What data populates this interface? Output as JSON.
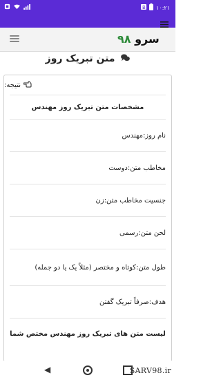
{
  "status_bar": {
    "time": "۱۰:۲۱",
    "left_icons": [
      "bug-icon",
      "wifi-icon",
      "signal-icon"
    ],
    "right_icons": [
      "battery-icon",
      "notification-icon"
    ]
  },
  "header": {
    "logo_word": "سرو",
    "logo_number": "۹۸"
  },
  "page": {
    "title": "متن تبریک روز",
    "title_icon": "chat-bubbles-icon"
  },
  "result": {
    "label": "نتیجه:",
    "label_icon": "hand-point-icon",
    "items": [
      {
        "text": "مشخصات متن تبریک روز مهندس",
        "bold": true
      },
      {
        "text": "نام روز:مهندس",
        "bold": false
      },
      {
        "text": "مخاطب متن:دوست",
        "bold": false
      },
      {
        "text": "جنسیت مخاطب متن:زن",
        "bold": false
      },
      {
        "text": "لحن متن:رسمی",
        "bold": false
      },
      {
        "text": "طول متن:کوتاه و مختصر (مثلاً یک یا دو جمله)",
        "bold": false
      },
      {
        "text": "هدف:صرفاً تبریک گفتن",
        "bold": false
      },
      {
        "text": "لیست متن های تبریک روز مهندس مختص شما",
        "bold": true
      }
    ]
  },
  "watermark": "SARV98.ir",
  "colors": {
    "status_bar": "#5b2bd6",
    "logo_number": "#2e8b3a"
  }
}
